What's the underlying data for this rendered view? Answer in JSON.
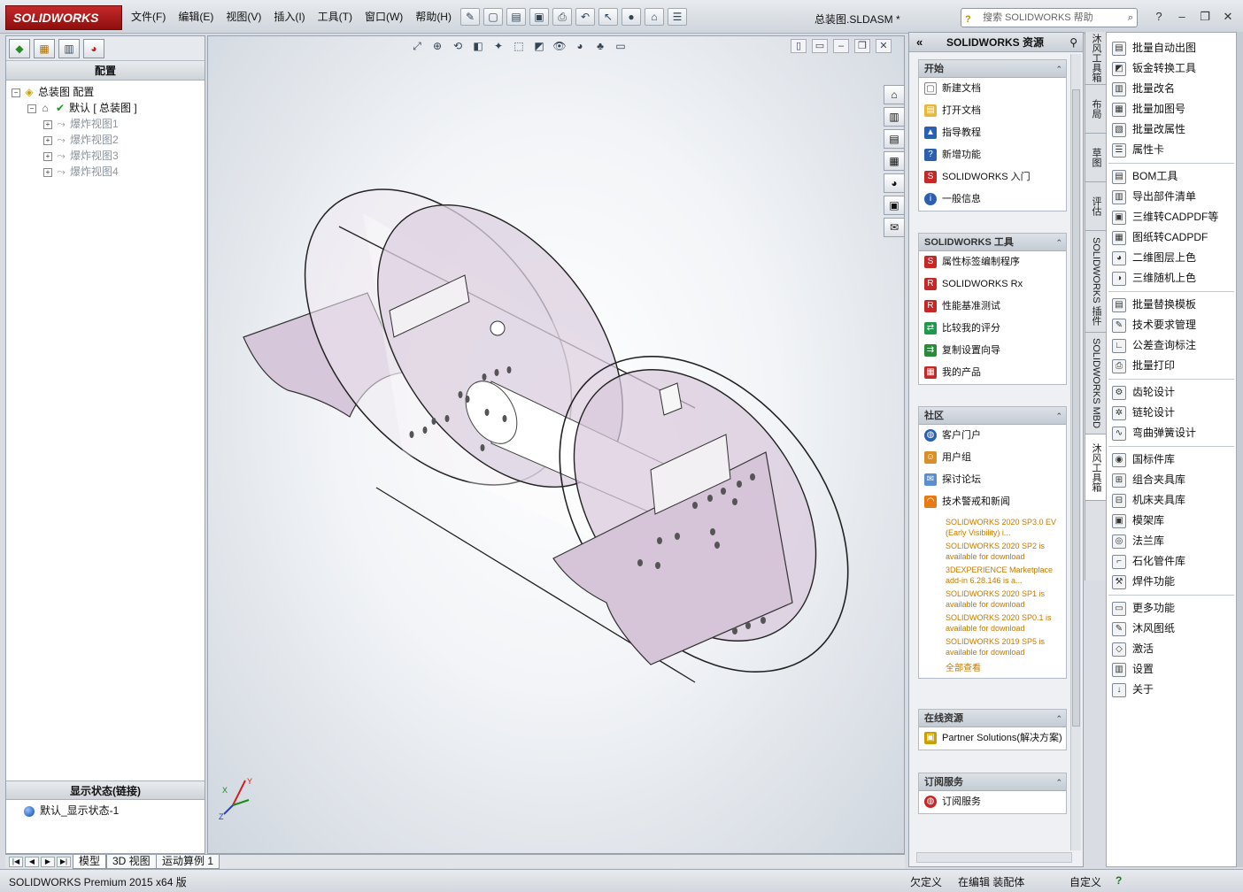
{
  "app": {
    "logo_text": "SOLIDWORKS",
    "document_title": "总装图.SLDASM *",
    "search_placeholder": "搜索 SOLIDWORKS 帮助"
  },
  "menu": [
    "文件(F)",
    "编辑(E)",
    "视图(V)",
    "插入(I)",
    "工具(T)",
    "窗口(W)",
    "帮助(H)"
  ],
  "left_panel": {
    "header": "配置",
    "tree": {
      "root": "总装图 配置",
      "default_config": "默认 [ 总装图 ]",
      "children": [
        "爆炸视图1",
        "爆炸视图2",
        "爆炸视图3",
        "爆炸视图4"
      ]
    },
    "display_state_header": "显示状态(链接)",
    "display_state_item": "默认_显示状态-1"
  },
  "bottom_tabs": [
    "模型",
    "3D 视图",
    "运动算例 1"
  ],
  "status": {
    "product": "SOLIDWORKS Premium 2015 x64 版",
    "under_defined": "欠定义",
    "editing": "在编辑 装配体",
    "custom": "自定义"
  },
  "resources": {
    "title": "SOLIDWORKS 资源",
    "start": {
      "header": "开始",
      "items": [
        "新建文档",
        "打开文档",
        "指导教程",
        "新增功能",
        "SOLIDWORKS 入门",
        "一般信息"
      ]
    },
    "tools": {
      "header": "SOLIDWORKS 工具",
      "items": [
        "属性标签编制程序",
        "SOLIDWORKS Rx",
        "性能基准测试",
        "比较我的评分",
        "复制设置向导",
        "我的产品"
      ]
    },
    "community": {
      "header": "社区",
      "items": [
        "客户门户",
        "用户组",
        "探讨论坛",
        "技术警戒和新闻"
      ],
      "news": [
        "SOLIDWORKS 2020 SP3.0 EV (Early Visibility) i...",
        "SOLIDWORKS 2020 SP2 is available for download",
        "3DEXPERIENCE Marketplace add-in 6.28.146 is a...",
        "SOLIDWORKS 2020 SP1 is available for download",
        "SOLIDWORKS 2020 SP0.1 is available for download",
        "SOLIDWORKS 2019 SP5 is available for download"
      ],
      "view_all": "全部查看"
    },
    "online": {
      "header": "在线资源",
      "items": [
        "Partner Solutions(解决方案)"
      ]
    },
    "subscription": {
      "header": "订阅服务",
      "items": [
        "订阅服务"
      ]
    }
  },
  "vertical_tabs": [
    "沐风工具箱",
    "布局",
    "草图",
    "评估",
    "SOLIDWORKS 插件",
    "SOLIDWORKS MBD",
    "沐风工具箱"
  ],
  "plugin": {
    "groups": [
      [
        "批量自动出图",
        "钣金转换工具",
        "批量改名",
        "批量加图号",
        "批量改属性",
        "属性卡"
      ],
      [
        "BOM工具",
        "导出部件清单",
        "三维转CADPDF等",
        "图纸转CADPDF",
        "二维图层上色",
        "三维随机上色"
      ],
      [
        "批量替换模板",
        "技术要求管理",
        "公差查询标注",
        "批量打印"
      ],
      [
        "齿轮设计",
        "链轮设计",
        "弯曲弹簧设计"
      ],
      [
        "国标件库",
        "组合夹具库",
        "机床夹具库",
        "模架库",
        "法兰库",
        "石化管件库",
        "焊件功能"
      ],
      [
        "更多功能",
        "沐风图纸",
        "激活",
        "设置",
        "关于"
      ]
    ]
  },
  "colors": {
    "accent": "#c62828",
    "part_face": "#d9c8dc",
    "news_link": "#c57a00"
  },
  "triad": {
    "x": "X",
    "y": "Y",
    "z": "Z"
  }
}
